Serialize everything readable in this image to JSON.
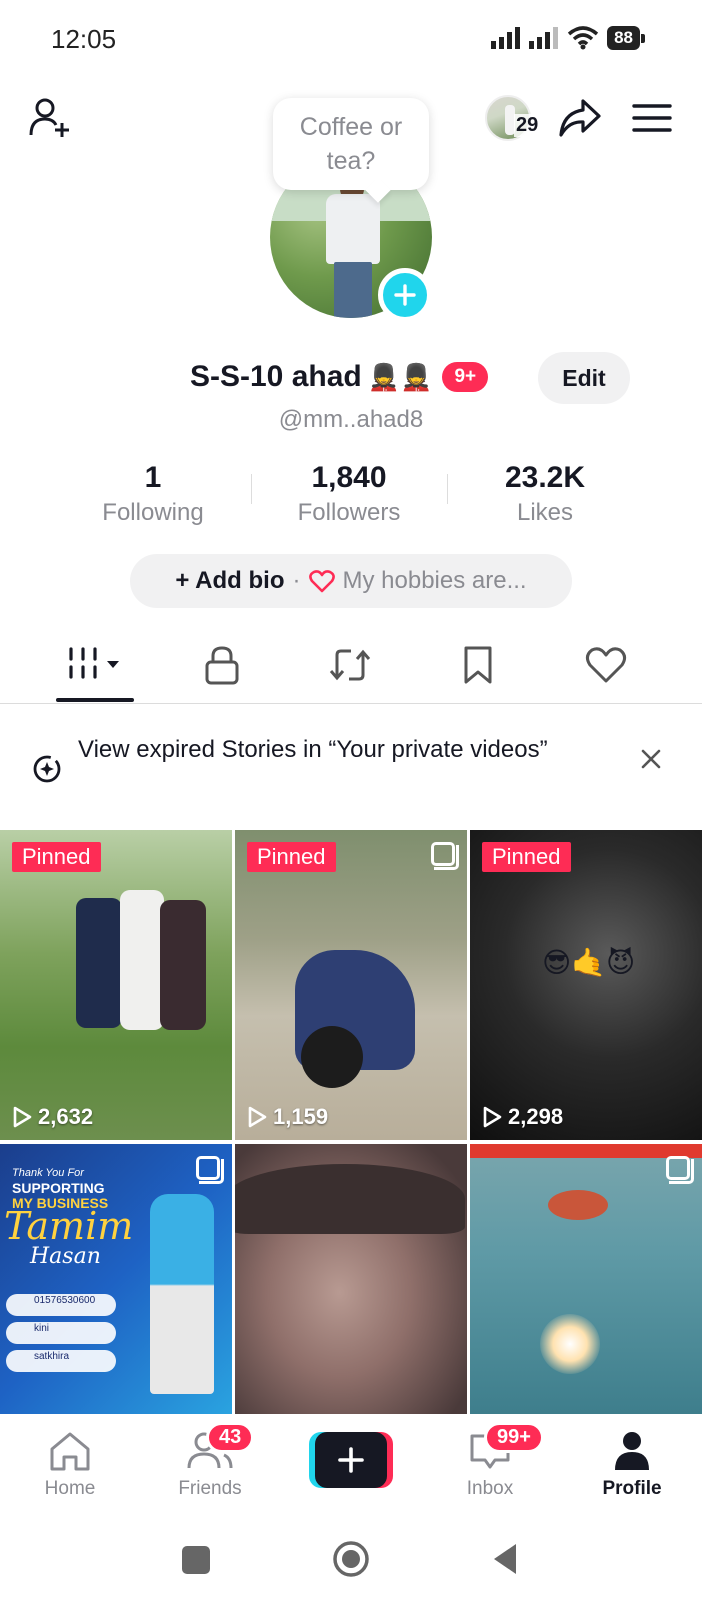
{
  "status_bar": {
    "time": "12:05",
    "battery": "88"
  },
  "header": {
    "story_count": "29",
    "icons": [
      "add-friend-icon",
      "story-avatar",
      "share-icon",
      "menu-icon"
    ]
  },
  "profile": {
    "bubble_text": "Coffee or tea?",
    "display_name": "S-S-10 ahad",
    "name_emojis": "💂💂",
    "notification_badge": "9+",
    "edit_label": "Edit",
    "username": "@mm..ahad8"
  },
  "stats": [
    {
      "value": "1",
      "label": "Following"
    },
    {
      "value": "1,840",
      "label": "Followers"
    },
    {
      "value": "23.2K",
      "label": "Likes"
    }
  ],
  "bio": {
    "add_label": "+ Add bio",
    "separator": "·",
    "hobby_text": "My hobbies are..."
  },
  "tabs": [
    "videos-grid-icon",
    "lock-icon",
    "repost-icon",
    "bookmark-icon",
    "heart-icon"
  ],
  "notice": {
    "text": "View expired Stories in “Your private videos”"
  },
  "grid": {
    "pinned_label": "Pinned",
    "items": [
      {
        "pinned": true,
        "views": "2,632"
      },
      {
        "pinned": true,
        "views": "1,159"
      },
      {
        "pinned": true,
        "views": "2,298",
        "overlay": "😎🤙😈"
      },
      {
        "pinned": false,
        "poster_line1": "Thank You For",
        "poster_line2": "SUPPORTING",
        "poster_line3": "MY BUSINESS",
        "poster_name": "Tamim",
        "poster_sub": "Hasan",
        "phone": "01576530600",
        "tiktok": "kini",
        "location": "satkhira"
      },
      {
        "pinned": false
      },
      {
        "pinned": false
      }
    ]
  },
  "bottom_nav": [
    {
      "label": "Home"
    },
    {
      "label": "Friends",
      "badge": "43"
    },
    {
      "label": ""
    },
    {
      "label": "Inbox",
      "badge": "99+"
    },
    {
      "label": "Profile"
    }
  ],
  "colors": {
    "accent": "#fe2c55",
    "cyan": "#20d5ec",
    "text": "#161823",
    "muted": "#8a8b91"
  }
}
